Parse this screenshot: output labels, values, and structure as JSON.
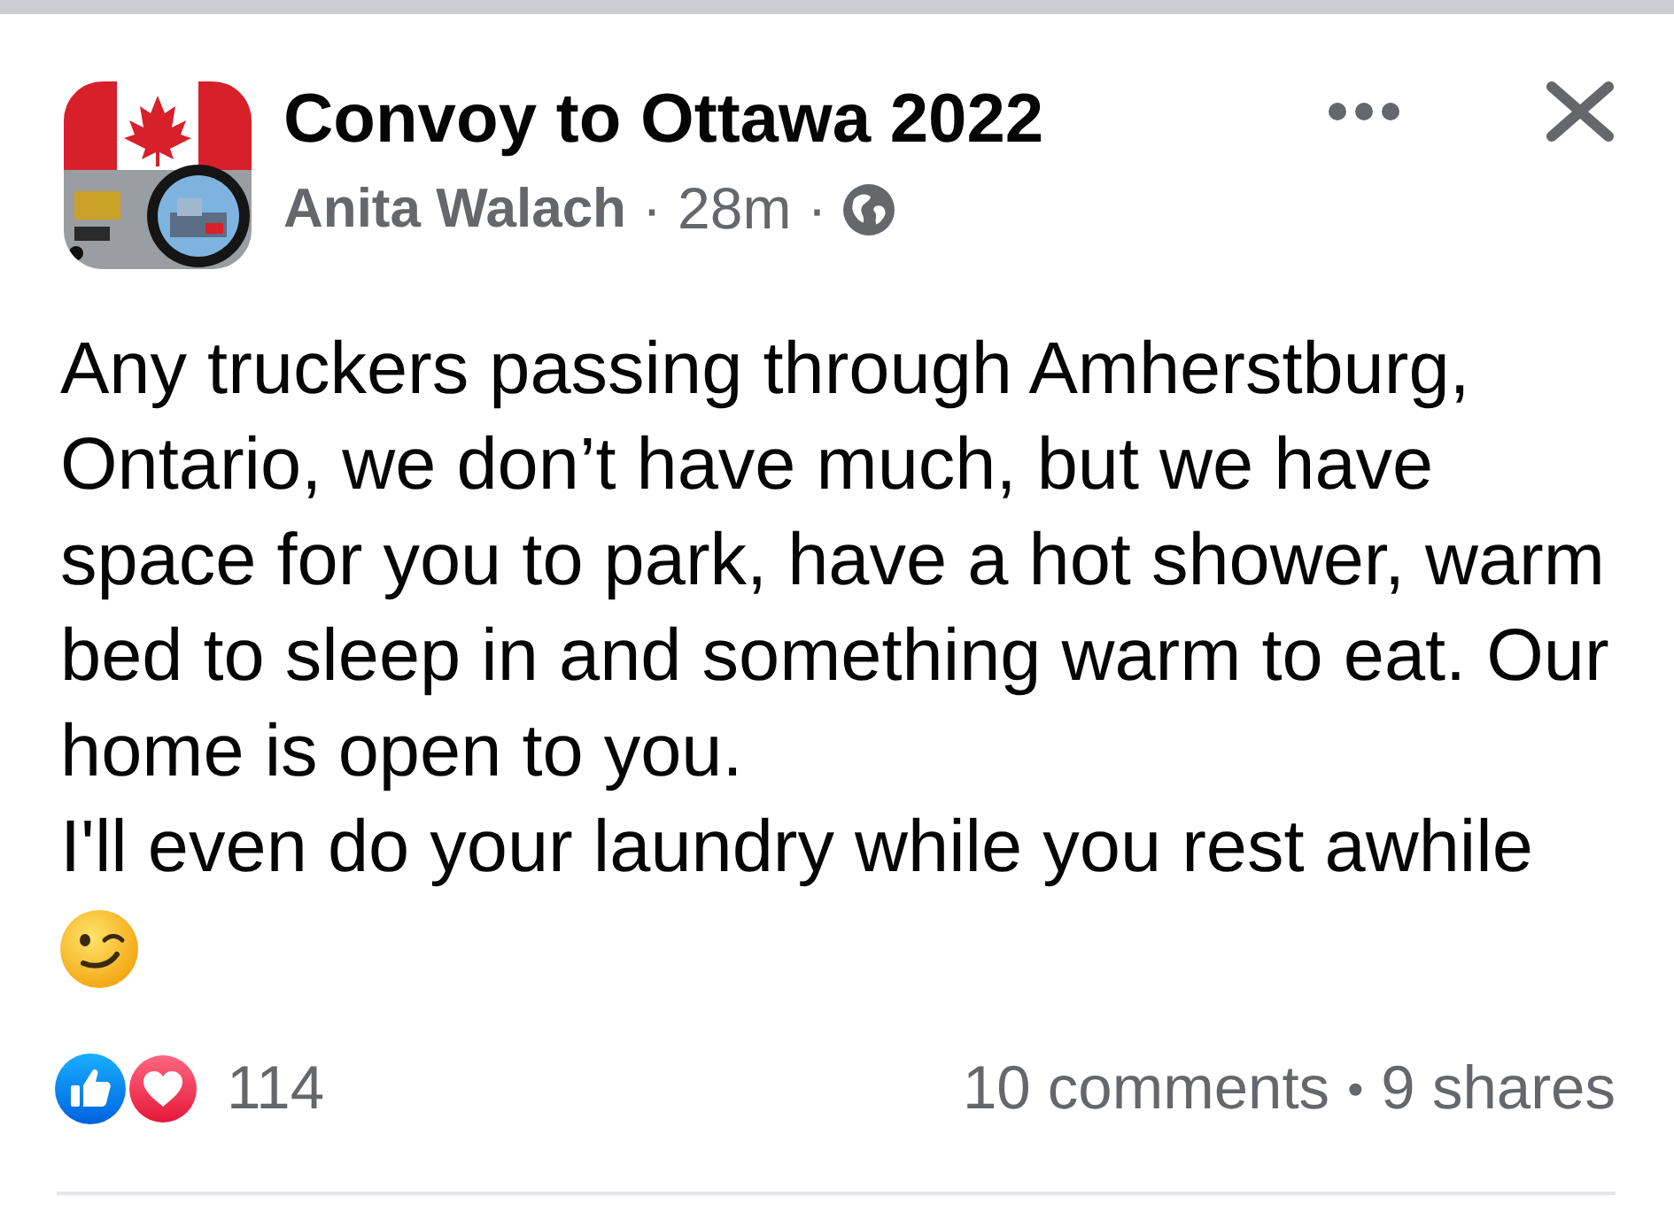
{
  "post": {
    "group": "Convoy to Ottawa 2022",
    "author": "Anita Walach",
    "separator_1": "·",
    "time": "28m",
    "separator_2": "·",
    "text": "Any truckers passing through Amherstburg,\nOntario, we don’t have much, but we have\nspace for you to park, have a hot shower, warm\nbed to sleep in and something warm to eat. Our\nhome is open to you.\nI'll even do your laundry while you rest awhile"
  },
  "footer": {
    "reaction_count": "114",
    "comments": "10 comments",
    "separator": "•",
    "shares": "9 shares"
  }
}
